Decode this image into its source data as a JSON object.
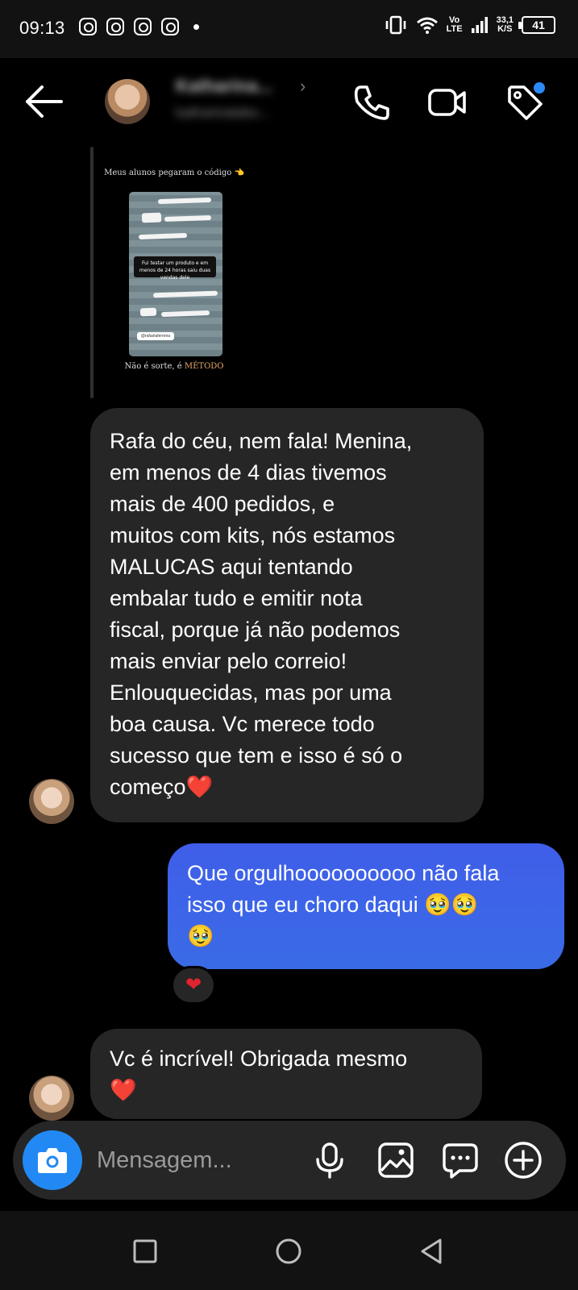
{
  "status_bar": {
    "time": "09:13",
    "network_top": "Vo",
    "network_bottom": "LTE",
    "speed_value": "33,1",
    "speed_unit": "K/S",
    "battery": "41",
    "notification_icons": [
      "instagram-icon",
      "instagram-icon",
      "instagram-icon",
      "instagram-icon"
    ]
  },
  "header": {
    "contact_name": "Katharina...",
    "contact_username": "katharinalabo...",
    "icons": [
      "back-arrow-icon",
      "phone-icon",
      "video-icon",
      "tag-icon"
    ],
    "tag_dot_color": "#2b8af7"
  },
  "story": {
    "caption_top": "Meus alunos pegaram o código 👈",
    "inner_text": "Fui testar um produto e em menos de 24 horas saiu duas vendas dele",
    "inner_tag": "@rafaelaferreira",
    "caption_bottom_plain": "Não é sorte, é ",
    "caption_bottom_accent": "MÉTODO"
  },
  "messages": [
    {
      "direction": "incoming",
      "lines": [
        "Rafa do céu, nem fala! Menina,",
        "em menos de 4 dias tivemos",
        "mais de 400 pedidos, e",
        "muitos com kits, nós estamos",
        "MALUCAS aqui tentando",
        "embalar tudo e emitir nota",
        "fiscal, porque já não podemos",
        "mais enviar pelo correio!",
        "Enlouquecidas, mas por uma",
        "boa causa. Vc merece todo",
        "sucesso que tem e isso é só o",
        "começo❤️"
      ]
    },
    {
      "direction": "outgoing",
      "lines": [
        "Que orgulhoooooooooo não fala",
        "isso que eu choro daqui 🥹🥹",
        "🥹"
      ],
      "reaction": "❤"
    },
    {
      "direction": "incoming",
      "lines": [
        "Vc é incrível! Obrigada mesmo",
        "❤️"
      ]
    }
  ],
  "composer": {
    "placeholder": "Mensagem...",
    "icons": [
      "camera-icon",
      "microphone-icon",
      "gallery-icon",
      "sticker-icon",
      "plus-icon"
    ],
    "camera_color": "#2289f4"
  },
  "nav_bar": {
    "icons": [
      "recents-icon",
      "home-icon",
      "back-triangle-icon"
    ]
  },
  "colors": {
    "incoming_bubble": "#262626",
    "outgoing_bubble": "#3d5ee8",
    "background": "#000000"
  }
}
